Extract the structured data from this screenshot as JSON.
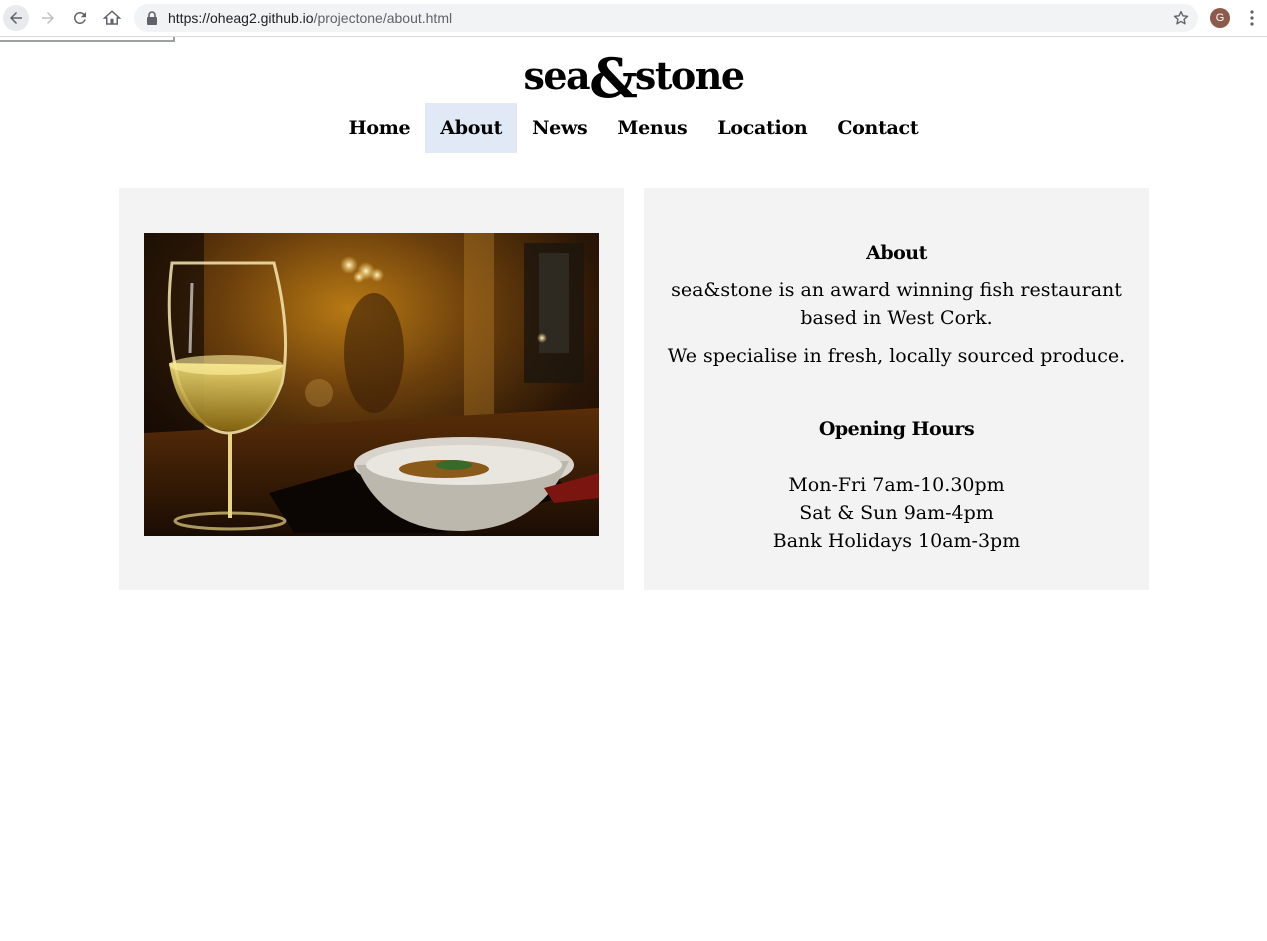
{
  "browser": {
    "url_host": "https://oheag2.github.io",
    "url_path": "/projectone/about.html",
    "avatar_letter": "G",
    "icons": [
      "back-arrow-icon",
      "forward-arrow-icon",
      "reload-icon",
      "home-icon",
      "lock-icon",
      "star-icon",
      "kebab-menu-icon"
    ]
  },
  "site": {
    "logo_left": "sea",
    "logo_amp": "&",
    "logo_right": "stone",
    "nav": [
      {
        "label": "Home"
      },
      {
        "label": "About"
      },
      {
        "label": "News"
      },
      {
        "label": "Menus"
      },
      {
        "label": "Location"
      },
      {
        "label": "Contact"
      }
    ],
    "active_nav": "About",
    "active_color": "#e2e9f6",
    "panel_color": "#f3f3f3"
  },
  "about": {
    "heading": "About",
    "paragraph1": "sea&stone is an award winning fish restaurant based in West Cork.",
    "paragraph2": "We specialise in fresh, locally sourced produce."
  },
  "hours": {
    "heading": "Opening Hours",
    "lines": [
      "Mon-Fri 7am-10.30pm",
      "Sat & Sun 9am-4pm",
      "Bank Holidays 10am-3pm"
    ]
  }
}
